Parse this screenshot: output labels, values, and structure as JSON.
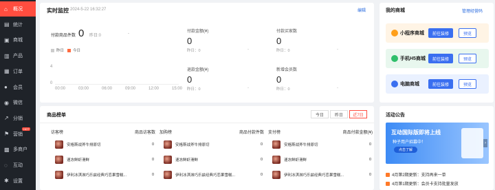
{
  "sidebar": {
    "items": [
      {
        "label": "概况",
        "icon": "home-icon"
      },
      {
        "label": "统计",
        "icon": "chart-icon"
      },
      {
        "label": "商城",
        "icon": "shop-icon"
      },
      {
        "label": "产品",
        "icon": "box-icon"
      },
      {
        "label": "订单",
        "icon": "order-icon"
      },
      {
        "label": "会员",
        "icon": "user-icon"
      },
      {
        "label": "微信",
        "icon": "wechat-icon"
      },
      {
        "label": "分销",
        "icon": "share-icon"
      },
      {
        "label": "营销",
        "icon": "flag-icon",
        "badge": "HOT"
      },
      {
        "label": "多商户",
        "icon": "store-icon"
      },
      {
        "label": "互动",
        "icon": "chat-icon"
      },
      {
        "label": "设置",
        "icon": "gear-icon"
      }
    ]
  },
  "realtime": {
    "title": "实时监控",
    "timestamp": "2024-5-22 16:32:27",
    "edit": "编辑",
    "paid_items_label": "付款商品件数",
    "paid_items_value": "0",
    "yesterday_inline": "昨日:0",
    "dash": "-",
    "legend_yesterday": "昨日",
    "legend_today": "今日",
    "yaxis": [
      "4",
      "0"
    ],
    "xaxis": [
      "00:00",
      "03:00",
      "06:00",
      "09:00",
      "12:00",
      "15:00"
    ],
    "metrics": [
      {
        "label": "付款金额(¥)",
        "value": "0",
        "sub": "昨日：0",
        "dash": "-"
      },
      {
        "label": "付款买家数",
        "value": "0",
        "sub": "昨日：0",
        "dash": "-"
      },
      {
        "label": "退款金额(¥)",
        "value": "0",
        "sub": "昨日：0",
        "dash": "-"
      },
      {
        "label": "新增会员数",
        "value": "0",
        "sub": "昨日：0",
        "dash": "-"
      }
    ]
  },
  "myshop": {
    "title": "我的商城",
    "manage": "管理经营码",
    "cards": [
      {
        "name": "小程序商城",
        "decorate": "前往装修",
        "preview": "预览",
        "bg": "#fff4e5",
        "icon_color": "#ff9f1a"
      },
      {
        "name": "手机H5商城",
        "decorate": "前往装修",
        "preview": "预览",
        "bg": "#e8f7ee",
        "icon_color": "#2fbf6b"
      },
      {
        "name": "电脑商城",
        "decorate": "前往装修",
        "preview": "预览",
        "bg": "#eaf1ff",
        "icon_color": "#3a6ff0"
      }
    ]
  },
  "ranking": {
    "title": "商品榜单",
    "tabs": [
      "今日",
      "昨日",
      "近7日"
    ],
    "columns": [
      {
        "head": "访客榜",
        "metric": "商品访客数",
        "rows": [
          {
            "name": "安格斯战斧牛排原切",
            "value": "0"
          },
          {
            "name": "速冻鲜虾滑鲜",
            "value": "0"
          },
          {
            "name": "伊利冰淇淋巧乐兹经典巧恋果雪糕...",
            "value": "0"
          }
        ]
      },
      {
        "head": "加购榜",
        "metric": "商品付款件数",
        "rows": [
          {
            "name": "安格斯战斧牛排原切",
            "value": "0"
          },
          {
            "name": "速冻鲜虾滑鲜",
            "value": "0"
          },
          {
            "name": "伊利冰淇淋巧乐兹经典巧恋果雪糕...",
            "value": "0"
          }
        ]
      },
      {
        "head": "支付榜",
        "metric": "商品付款金额(¥)",
        "rows": [
          {
            "name": "安格斯战斧牛排原切",
            "value": "0"
          },
          {
            "name": "速冻鲜虾滑鲜",
            "value": "0"
          },
          {
            "name": "伊利冰淇淋巧乐兹经典巧恋果雪糕...",
            "value": "0"
          }
        ]
      }
    ]
  },
  "announce": {
    "title": "活动公告",
    "banner_title": "互动国际版即将上线",
    "banner_sub": "种子用户招募中！",
    "banner_btn": "点击了解",
    "items": [
      {
        "text": "4月第2期更新：支持再来一单"
      },
      {
        "text": "4月第1期更新：会员卡支持批量发放"
      }
    ]
  }
}
